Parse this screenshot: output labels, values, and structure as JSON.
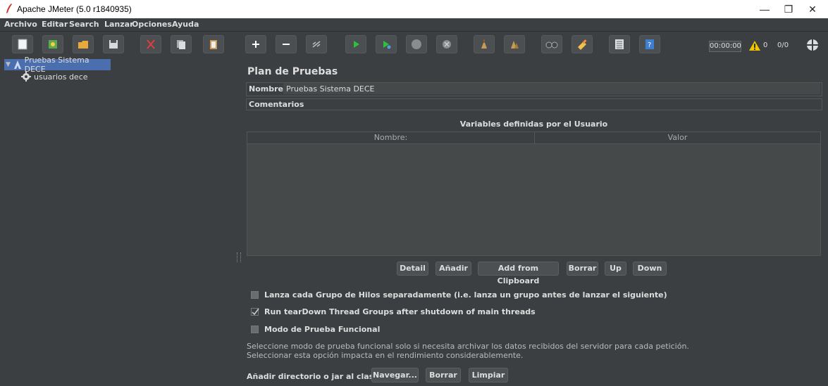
{
  "window": {
    "title": "Apache JMeter (5.0 r1840935)"
  },
  "menu": [
    "Archivo",
    "Editar",
    "Search",
    "Lanzar",
    "Opciones",
    "Ayuda"
  ],
  "toolbar": {
    "timer": "00:00:00",
    "warnings": "0",
    "threads": "0/0",
    "icons": [
      "new-icon",
      "templates-icon",
      "open-icon",
      "save-icon",
      "cut-icon",
      "copy-icon",
      "paste-icon",
      "expand-icon",
      "collapse-icon",
      "toggle-icon",
      "start-icon",
      "start-no-pause-icon",
      "stop-icon",
      "shutdown-icon",
      "clear-icon",
      "clear-all-icon",
      "search-icon",
      "reset-search-icon",
      "function-helper-icon",
      "help-icon"
    ]
  },
  "tree": {
    "items": [
      {
        "label": "Pruebas Sistema DECE",
        "icon": "test-plan-icon",
        "selected": true
      },
      {
        "label": "usuarios dece",
        "icon": "thread-group-icon",
        "selected": false
      }
    ]
  },
  "panel": {
    "title": "Plan de Pruebas",
    "name_label": "Nombre:",
    "name_value": "Pruebas Sistema DECE",
    "comments_label": "Comentarios",
    "vars_title": "Variables definidas por el Usuario",
    "col_name": "Nombre:",
    "col_value": "Valor",
    "buttons": {
      "detail": "Detail",
      "add": "Añadir",
      "clipboard": "Add from Clipboard",
      "delete": "Borrar",
      "up": "Up",
      "down": "Down"
    },
    "checks": {
      "separate": {
        "label": "Lanza cada Grupo de Hilos separadamente (i.e. lanza un grupo antes de lanzar el siguiente)",
        "checked": false
      },
      "teardown": {
        "label": "Run tearDown Thread Groups after shutdown of main threads",
        "checked": true
      },
      "functional": {
        "label": "Modo de Prueba Funcional",
        "checked": false
      }
    },
    "help_line1": "Seleccione modo de prueba funcional solo si necesita archivar los datos recibidos del servidor para cada petición.",
    "help_line2": "Seleccionar esta opción impacta en el rendimiento considerablemente.",
    "classpath_label": "Añadir directorio o jar al classpath",
    "classpath_buttons": {
      "browse": "Navegar...",
      "delete": "Borrar",
      "clear": "Limpiar"
    }
  }
}
